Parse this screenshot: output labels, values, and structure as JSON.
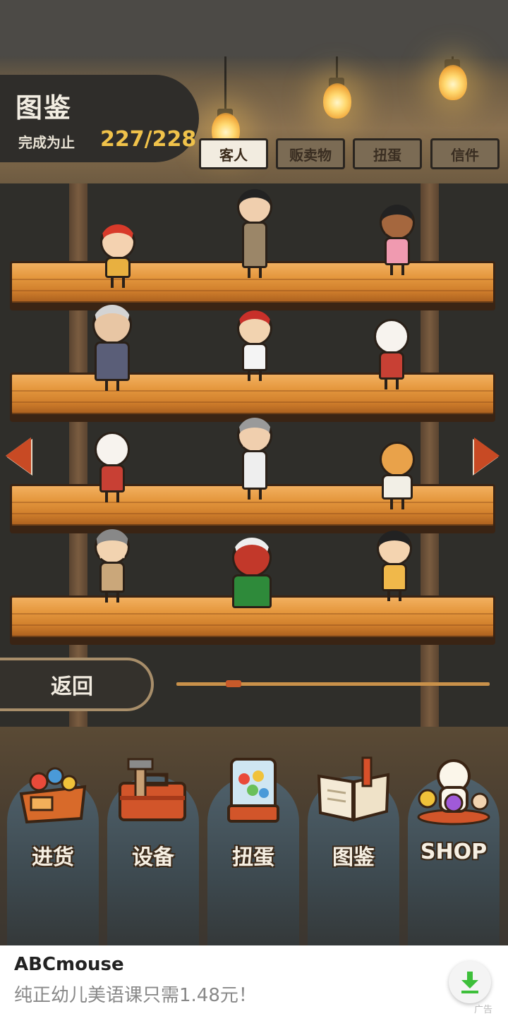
{
  "header": {
    "title": "图鉴",
    "progress_label": "完成为止",
    "progress_value": "227/228"
  },
  "tabs": [
    {
      "label": "客人",
      "active": true
    },
    {
      "label": "贩卖物",
      "active": false
    },
    {
      "label": "扭蛋",
      "active": false
    },
    {
      "label": "信件",
      "active": false
    }
  ],
  "shelves": {
    "rows": 4,
    "characters_per_row": 3
  },
  "navigation": {
    "back_label": "返回",
    "page_slider_fraction": 0.17
  },
  "bottom_menu": [
    {
      "label": "进货",
      "icon": "stock-basket-icon"
    },
    {
      "label": "设备",
      "icon": "toolbox-icon"
    },
    {
      "label": "扭蛋",
      "icon": "gacha-machine-icon"
    },
    {
      "label": "图鉴",
      "icon": "open-book-icon"
    },
    {
      "label": "SHOP",
      "icon": "lucky-cat-icon"
    }
  ],
  "ad": {
    "title": "ABCmouse",
    "subtitle": "纯正幼儿美语课只需1.48元！",
    "tag": "广告"
  },
  "colors": {
    "accent_gold": "#f0c24a",
    "arrow_red": "#c84a24",
    "shelf_wood": "#e5983e",
    "download_green": "#3dbf3a"
  }
}
